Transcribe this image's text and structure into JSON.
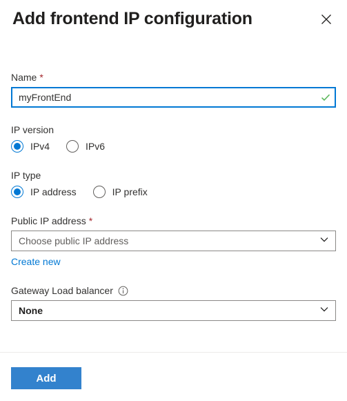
{
  "header": {
    "title": "Add frontend IP configuration",
    "close_icon": "close-icon"
  },
  "form": {
    "name_field": {
      "label": "Name",
      "required_marker": "*",
      "value": "myFrontEnd",
      "placeholder": "",
      "validation_icon": "checkmark-icon",
      "validation_color": "#5cb85c"
    },
    "ip_version": {
      "label": "IP version",
      "selected": "IPv4",
      "options": [
        {
          "label": "IPv4",
          "selected": true
        },
        {
          "label": "IPv6",
          "selected": false
        }
      ]
    },
    "ip_type": {
      "label": "IP type",
      "selected": "IP address",
      "options": [
        {
          "label": "IP address",
          "selected": true
        },
        {
          "label": "IP prefix",
          "selected": false
        }
      ]
    },
    "public_ip": {
      "label": "Public IP address",
      "required_marker": "*",
      "value": "",
      "placeholder": "Choose public IP address",
      "chevron_icon": "chevron-down-icon",
      "create_link": "Create new"
    },
    "gateway_lb": {
      "label": "Gateway Load balancer",
      "info_icon": "info-icon",
      "value": "None",
      "chevron_icon": "chevron-down-icon"
    }
  },
  "footer": {
    "add_label": "Add"
  },
  "colors": {
    "accent": "#0078d4",
    "primary_button": "#3382cd",
    "required": "#a4262c",
    "link": "#0078d4",
    "success": "#5cb85c",
    "border": "#8a8886",
    "divider": "#edebe9"
  }
}
